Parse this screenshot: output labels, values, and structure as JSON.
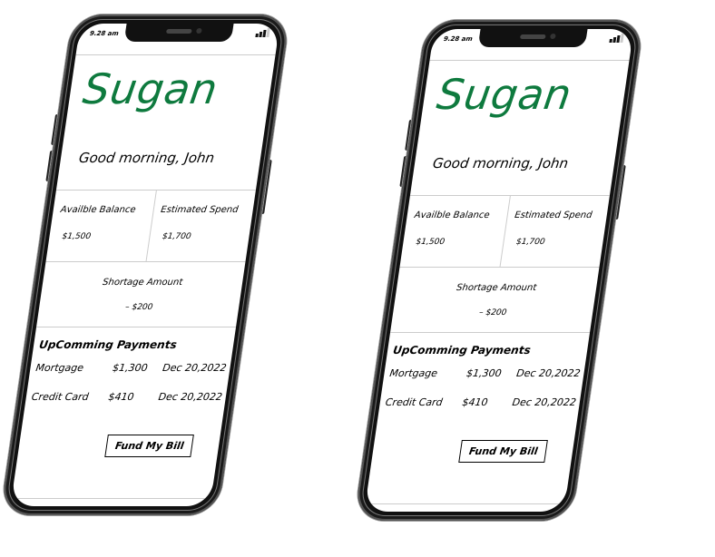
{
  "phones": [
    {
      "status_time": "9.28 am",
      "logo": "Sugan",
      "greeting": "Good morning, John",
      "available_balance_label": "Availble Balance",
      "available_balance_value": "$1,500",
      "estimated_spend_label": "Estimated Spend",
      "estimated_spend_value": "$1,700",
      "shortage_label": "Shortage Amount",
      "shortage_value": "– $200",
      "payments_title": "UpComming Payments",
      "payments": [
        {
          "name": "Mortgage",
          "amount": "$1,300",
          "date": "Dec 20,2022"
        },
        {
          "name": "Credit Card",
          "amount": "$410",
          "date": "Dec 20,2022"
        }
      ],
      "fund_button": "Fund My Bill"
    },
    {
      "status_time": "9.28 am",
      "logo": "Sugan",
      "greeting": "Good morning, John",
      "available_balance_label": "Availble Balance",
      "available_balance_value": "$1,500",
      "estimated_spend_label": "Estimated Spend",
      "estimated_spend_value": "$1,700",
      "shortage_label": "Shortage Amount",
      "shortage_value": "– $200",
      "payments_title": "UpComming Payments",
      "payments": [
        {
          "name": "Mortgage",
          "amount": "$1,300",
          "date": "Dec 20,2022"
        },
        {
          "name": "Credit Card",
          "amount": "$410",
          "date": "Dec 20,2022"
        }
      ],
      "fund_button": "Fund My Bill"
    }
  ],
  "colors": {
    "brand": "#0e7a3e",
    "frame": "#111111"
  }
}
